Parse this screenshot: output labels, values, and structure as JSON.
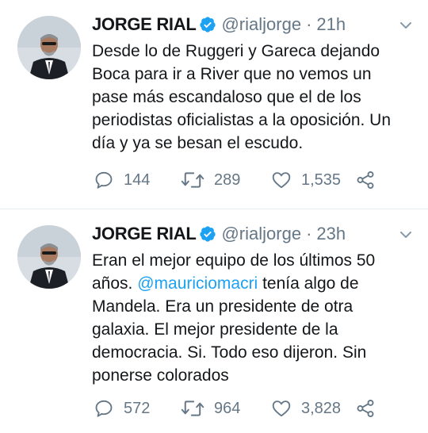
{
  "tweets": [
    {
      "name": "JORGE RIAL",
      "handle": "@rialjorge",
      "separator": "·",
      "time": "21h",
      "text_before": "Desde lo de Ruggeri y Gareca dejando Boca para ir a River que no vemos un pase más escandaloso que el de los periodistas oficialistas a la oposición. Un día y ya se besan el escudo.",
      "mention": "",
      "text_after": "",
      "replies": "144",
      "retweets": "289",
      "likes": "1,535"
    },
    {
      "name": "JORGE RIAL",
      "handle": "@rialjorge",
      "separator": "·",
      "time": "23h",
      "text_before": "Eran el mejor equipo de los últimos 50 años. ",
      "mention": "@mauriciomacri",
      "text_after": " tenía algo de Mandela. Era un presidente de otra galaxia. El mejor presidente de la democracia. Si. Todo eso dijeron. Sin ponerse colorados",
      "replies": "572",
      "retweets": "964",
      "likes": "3,828"
    }
  ],
  "icons": {
    "verified": "verified-badge-icon",
    "caret": "chevron-down-icon",
    "reply": "reply-icon",
    "retweet": "retweet-icon",
    "like": "heart-icon",
    "share": "share-icon"
  },
  "colors": {
    "accent": "#1da1f2",
    "text": "#14171a",
    "muted": "#657786"
  }
}
